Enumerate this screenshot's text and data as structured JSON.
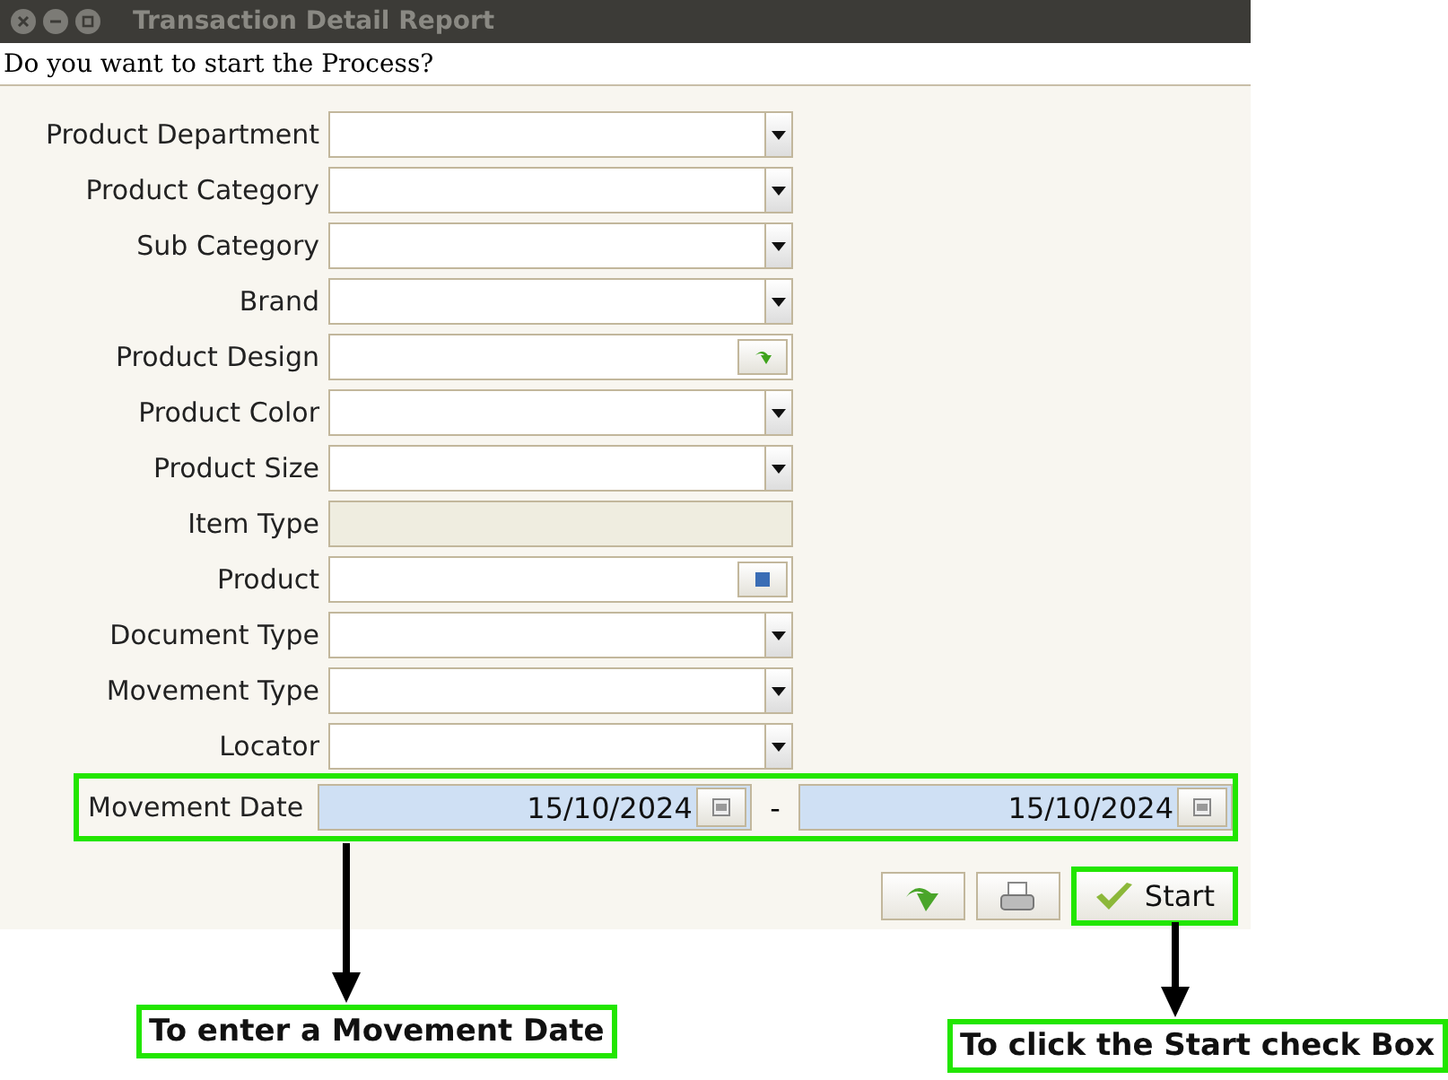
{
  "window": {
    "title": "Transaction Detail Report"
  },
  "prompt": "Do you want to start the Process?",
  "fields": [
    {
      "label": "Product Department",
      "kind": "select"
    },
    {
      "label": "Product Category",
      "kind": "select"
    },
    {
      "label": "Sub Category",
      "kind": "select"
    },
    {
      "label": "Brand",
      "kind": "select"
    },
    {
      "label": "Product Design",
      "kind": "picker"
    },
    {
      "label": "Product Color",
      "kind": "select"
    },
    {
      "label": "Product Size",
      "kind": "select"
    },
    {
      "label": "Item Type",
      "kind": "readonly"
    },
    {
      "label": "Product",
      "kind": "lookup"
    },
    {
      "label": "Document Type",
      "kind": "select"
    },
    {
      "label": "Movement Type",
      "kind": "select"
    },
    {
      "label": "Locator",
      "kind": "select"
    }
  ],
  "movement_date": {
    "label": "Movement Date",
    "from": "15/10/2024",
    "separator": "-",
    "to": "15/10/2024"
  },
  "start_button": {
    "label": "Start"
  },
  "annotations": [
    {
      "text": "To enter a Movement Date"
    },
    {
      "text": "To click the Start check Box"
    }
  ]
}
